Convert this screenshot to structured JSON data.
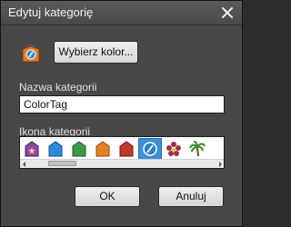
{
  "dialog": {
    "title": "Edytuj kategorię",
    "color_button_label": "Wybierz kolor...",
    "name_label": "Nazwa kategorii",
    "name_value": "ColorTag",
    "icon_label": "Ikona kategorii",
    "ok_label": "OK",
    "cancel_label": "Anuluj"
  },
  "icons": [
    {
      "name": "purple-tag-star-icon",
      "color": "#8e44ad"
    },
    {
      "name": "blue-tag-icon",
      "color": "#2e86de"
    },
    {
      "name": "green-tag-icon",
      "color": "#3c9a4a"
    },
    {
      "name": "orange-tag-icon",
      "color": "#e67e22"
    },
    {
      "name": "red-tag-icon",
      "color": "#c0392b"
    },
    {
      "name": "color-tag-icon",
      "color": "#2a7fc7",
      "selected": true
    },
    {
      "name": "flower-icon",
      "color": "#a0304a"
    },
    {
      "name": "palm-tree-icon",
      "color": "#3c8a2a"
    }
  ],
  "colors": {
    "preview_tag": "#e07a2a",
    "selection": "#3d8fd6"
  }
}
